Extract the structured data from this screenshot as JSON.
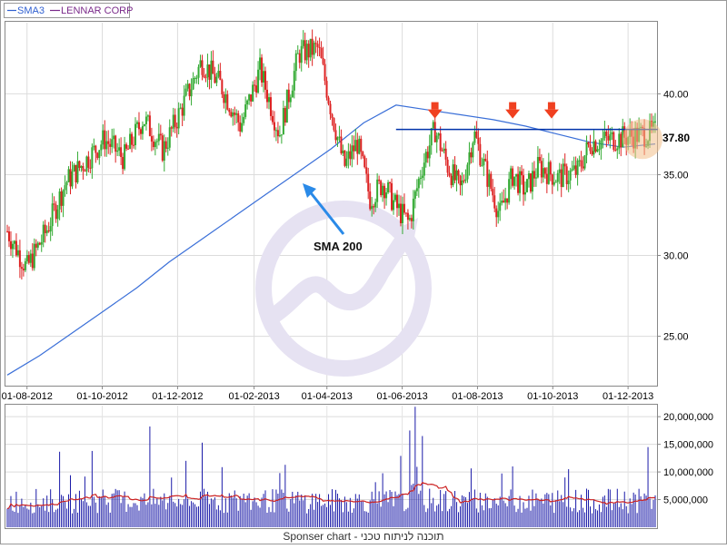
{
  "legend": [
    {
      "label": "SMA3",
      "color": "#2f5fd0"
    },
    {
      "label": "LENNAR CORP",
      "color": "#7a2a8a"
    }
  ],
  "footer": "Sponser chart - תוכנה לניתוח טכני",
  "annotations": {
    "sma_label": "SMA 200",
    "resistance_label": "37.80",
    "resistance_level": 37.8
  },
  "colors": {
    "up": "#33aa33",
    "down": "#dd2222",
    "sma": "#3a6fd8",
    "volume": "#1a1aa8",
    "volume_avg": "#cc2222",
    "resistance": "#0033aa",
    "arrow": "#f04020",
    "highlight": "#f3c08a",
    "watermark": "#e2def0"
  },
  "chart_data": [
    {
      "type": "candlestick",
      "x_tick_labels": [
        "01-08-2012",
        "01-10-2012",
        "01-12-2012",
        "01-02-2013",
        "01-04-2013",
        "01-06-2013",
        "01-08-2013",
        "01-10-2013",
        "01-12-2013"
      ],
      "x_range": [
        "2012-07-16",
        "2013-12-23"
      ],
      "y_ticks": [
        "25.00",
        "30.00",
        "35.00",
        "40.00"
      ],
      "ylim": [
        22,
        44.4
      ],
      "grid": true,
      "sma200": {
        "name": "SMA3",
        "points": [
          [
            0,
            22.6
          ],
          [
            0.05,
            23.8
          ],
          [
            0.1,
            25.2
          ],
          [
            0.15,
            26.6
          ],
          [
            0.2,
            28.0
          ],
          [
            0.25,
            29.6
          ],
          [
            0.3,
            31.0
          ],
          [
            0.35,
            32.4
          ],
          [
            0.4,
            33.8
          ],
          [
            0.45,
            35.2
          ],
          [
            0.5,
            36.6
          ],
          [
            0.55,
            38.2
          ],
          [
            0.6,
            39.3
          ],
          [
            0.65,
            39.0
          ],
          [
            0.7,
            38.7
          ],
          [
            0.75,
            38.4
          ],
          [
            0.8,
            38.0
          ],
          [
            0.85,
            37.5
          ],
          [
            0.9,
            37.0
          ],
          [
            0.95,
            36.7
          ],
          [
            1.0,
            36.9
          ]
        ]
      },
      "price_path": [
        [
          0,
          31.5
        ],
        [
          0.03,
          29.2
        ],
        [
          0.06,
          31.5
        ],
        [
          0.09,
          34.5
        ],
        [
          0.12,
          35.8
        ],
        [
          0.15,
          37.2
        ],
        [
          0.18,
          36.0
        ],
        [
          0.21,
          38.5
        ],
        [
          0.24,
          36.5
        ],
        [
          0.27,
          39.2
        ],
        [
          0.3,
          42.0
        ],
        [
          0.33,
          40.5
        ],
        [
          0.36,
          38.0
        ],
        [
          0.39,
          41.5
        ],
        [
          0.42,
          37.5
        ],
        [
          0.45,
          42.5
        ],
        [
          0.48,
          42.8
        ],
        [
          0.5,
          39.0
        ],
        [
          0.52,
          35.5
        ],
        [
          0.54,
          37.0
        ],
        [
          0.56,
          33.5
        ],
        [
          0.58,
          34.5
        ],
        [
          0.6,
          33.0
        ],
        [
          0.62,
          32.0
        ],
        [
          0.64,
          35.5
        ],
        [
          0.66,
          37.8
        ],
        [
          0.68,
          35.5
        ],
        [
          0.7,
          34.0
        ],
        [
          0.72,
          37.6
        ],
        [
          0.74,
          35.0
        ],
        [
          0.76,
          32.5
        ],
        [
          0.78,
          35.0
        ],
        [
          0.8,
          34.0
        ],
        [
          0.82,
          35.5
        ],
        [
          0.85,
          34.8
        ],
        [
          0.88,
          35.2
        ],
        [
          0.9,
          37.0
        ],
        [
          1.0,
          37.6
        ]
      ],
      "markers_at": [
        0.66,
        0.78,
        0.84
      ]
    },
    {
      "type": "bar",
      "name": "volume",
      "y_ticks": [
        "5,000,000",
        "10,000,000",
        "15,000,000",
        "20,000,000"
      ],
      "ylim": [
        0,
        22000000
      ],
      "spikes": [
        [
          0.13,
          13800000
        ],
        [
          0.22,
          12000000
        ],
        [
          0.3,
          10500000
        ],
        [
          0.42,
          9800000
        ],
        [
          0.62,
          17500000
        ],
        [
          0.63,
          21800000
        ],
        [
          0.64,
          16500000
        ],
        [
          0.78,
          11000000
        ],
        [
          0.86,
          9000000
        ],
        [
          0.99,
          14500000
        ]
      ]
    }
  ]
}
